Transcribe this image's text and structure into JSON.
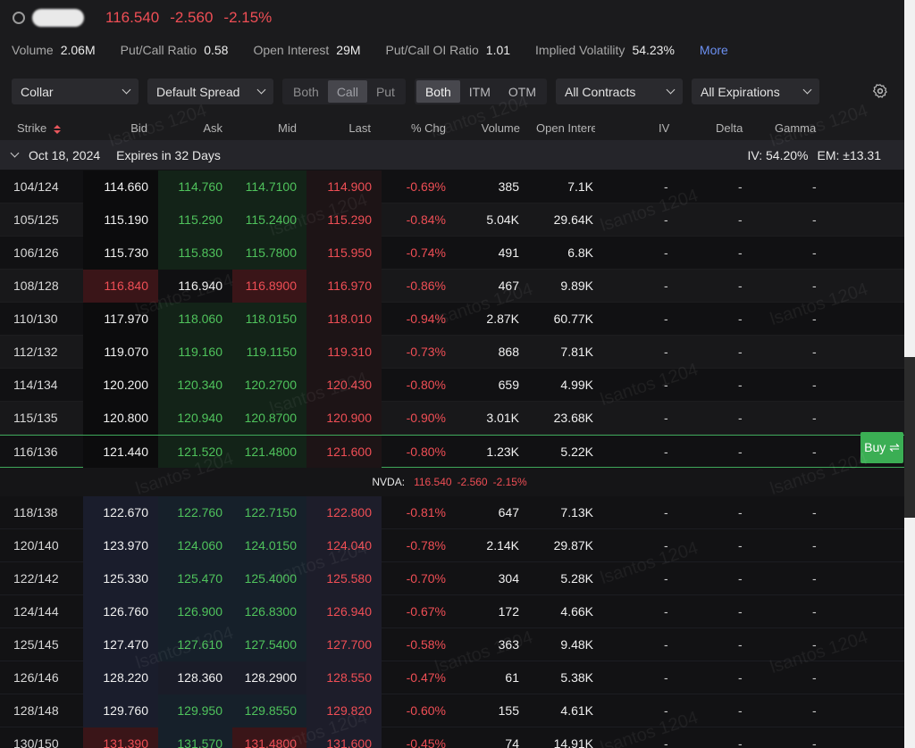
{
  "quote": {
    "price": "116.540",
    "change": "-2.560",
    "change_pct": "-2.15%"
  },
  "stats": [
    {
      "label": "Volume",
      "value": "2.06M"
    },
    {
      "label": "Put/Call Ratio",
      "value": "0.58"
    },
    {
      "label": "Open Interest",
      "value": "29M"
    },
    {
      "label": "Put/Call OI Ratio",
      "value": "1.01"
    },
    {
      "label": "Implied Volatility",
      "value": "54.23%"
    }
  ],
  "more_label": "More",
  "toolbar": {
    "strategy": "Collar",
    "spread": "Default Spread",
    "side_options": [
      "Both",
      "Call",
      "Put"
    ],
    "side_selected": "Call",
    "money_options": [
      "Both",
      "ITM",
      "OTM"
    ],
    "money_selected": "Both",
    "contracts": "All Contracts",
    "expirations": "All Expirations"
  },
  "columns": {
    "strike": "Strike",
    "bid": "Bid",
    "ask": "Ask",
    "mid": "Mid",
    "last": "Last",
    "chg": "% Chg",
    "volume": "Volume",
    "oi": "Open Intere",
    "iv": "IV",
    "delta": "Delta",
    "gamma": "Gamma"
  },
  "expiry": {
    "date": "Oct 18, 2024",
    "days": "Expires in 32 Days",
    "iv": "IV: 54.20%",
    "em": "EM: ±13.31"
  },
  "underlying": {
    "label": "NVDA:",
    "price": "116.540",
    "change": "-2.560",
    "change_pct": "-2.15%"
  },
  "buy_label": "Buy ⇌",
  "watermark": "lsantos 1204",
  "colors": {
    "green": "#4fc35c",
    "red": "#ef4e55",
    "buy": "#3bae54",
    "link": "#6b8ff0"
  },
  "rows_above": [
    {
      "strike": "104/124",
      "bid": "114.660",
      "ask": "114.760",
      "mid": "114.7100",
      "last": "114.900",
      "chg": "-0.69%",
      "volume": "385",
      "oi": "7.1K",
      "iv": "-",
      "delta": "-",
      "gamma": "-",
      "tone": [
        "white",
        "green",
        "green",
        "red"
      ]
    },
    {
      "strike": "105/125",
      "bid": "115.190",
      "ask": "115.290",
      "mid": "115.2400",
      "last": "115.290",
      "chg": "-0.84%",
      "volume": "5.04K",
      "oi": "29.64K",
      "iv": "-",
      "delta": "-",
      "gamma": "-",
      "tone": [
        "white",
        "green",
        "green",
        "red"
      ]
    },
    {
      "strike": "106/126",
      "bid": "115.730",
      "ask": "115.830",
      "mid": "115.7800",
      "last": "115.950",
      "chg": "-0.74%",
      "volume": "491",
      "oi": "6.8K",
      "iv": "-",
      "delta": "-",
      "gamma": "-",
      "tone": [
        "white",
        "green",
        "green",
        "red"
      ]
    },
    {
      "strike": "108/128",
      "bid": "116.840",
      "ask": "116.940",
      "mid": "116.8900",
      "last": "116.970",
      "chg": "-0.86%",
      "volume": "467",
      "oi": "9.89K",
      "iv": "-",
      "delta": "-",
      "gamma": "-",
      "tone": [
        "red",
        "white",
        "red",
        "red"
      ]
    },
    {
      "strike": "110/130",
      "bid": "117.970",
      "ask": "118.060",
      "mid": "118.0150",
      "last": "118.010",
      "chg": "-0.94%",
      "volume": "2.87K",
      "oi": "60.77K",
      "iv": "-",
      "delta": "-",
      "gamma": "-",
      "tone": [
        "white",
        "green",
        "green",
        "red"
      ]
    },
    {
      "strike": "112/132",
      "bid": "119.070",
      "ask": "119.160",
      "mid": "119.1150",
      "last": "119.310",
      "chg": "-0.73%",
      "volume": "868",
      "oi": "7.81K",
      "iv": "-",
      "delta": "-",
      "gamma": "-",
      "tone": [
        "white",
        "green",
        "green",
        "red"
      ]
    },
    {
      "strike": "114/134",
      "bid": "120.200",
      "ask": "120.340",
      "mid": "120.2700",
      "last": "120.430",
      "chg": "-0.80%",
      "volume": "659",
      "oi": "4.99K",
      "iv": "-",
      "delta": "-",
      "gamma": "-",
      "tone": [
        "white",
        "green",
        "green",
        "red"
      ]
    },
    {
      "strike": "115/135",
      "bid": "120.800",
      "ask": "120.940",
      "mid": "120.8700",
      "last": "120.900",
      "chg": "-0.90%",
      "volume": "3.01K",
      "oi": "23.68K",
      "iv": "-",
      "delta": "-",
      "gamma": "-",
      "tone": [
        "white",
        "green",
        "green",
        "red"
      ]
    },
    {
      "strike": "116/136",
      "bid": "121.440",
      "ask": "121.520",
      "mid": "121.4800",
      "last": "121.600",
      "chg": "-0.80%",
      "volume": "1.23K",
      "oi": "5.22K",
      "iv": "-",
      "delta": "-",
      "gamma": "-",
      "tone": [
        "white",
        "green",
        "green",
        "red"
      ]
    }
  ],
  "rows_below": [
    {
      "strike": "118/138",
      "bid": "122.670",
      "ask": "122.760",
      "mid": "122.7150",
      "last": "122.800",
      "chg": "-0.81%",
      "volume": "647",
      "oi": "7.13K",
      "iv": "-",
      "delta": "-",
      "gamma": "-",
      "tone": [
        "white",
        "green",
        "green",
        "red"
      ]
    },
    {
      "strike": "120/140",
      "bid": "123.970",
      "ask": "124.060",
      "mid": "124.0150",
      "last": "124.040",
      "chg": "-0.78%",
      "volume": "2.14K",
      "oi": "29.87K",
      "iv": "-",
      "delta": "-",
      "gamma": "-",
      "tone": [
        "white",
        "green",
        "green",
        "red"
      ]
    },
    {
      "strike": "122/142",
      "bid": "125.330",
      "ask": "125.470",
      "mid": "125.4000",
      "last": "125.580",
      "chg": "-0.70%",
      "volume": "304",
      "oi": "5.28K",
      "iv": "-",
      "delta": "-",
      "gamma": "-",
      "tone": [
        "white",
        "green",
        "green",
        "red"
      ]
    },
    {
      "strike": "124/144",
      "bid": "126.760",
      "ask": "126.900",
      "mid": "126.8300",
      "last": "126.940",
      "chg": "-0.67%",
      "volume": "172",
      "oi": "4.66K",
      "iv": "-",
      "delta": "-",
      "gamma": "-",
      "tone": [
        "white",
        "green",
        "green",
        "red"
      ]
    },
    {
      "strike": "125/145",
      "bid": "127.470",
      "ask": "127.610",
      "mid": "127.5400",
      "last": "127.700",
      "chg": "-0.58%",
      "volume": "363",
      "oi": "9.48K",
      "iv": "-",
      "delta": "-",
      "gamma": "-",
      "tone": [
        "white",
        "green",
        "green",
        "red"
      ]
    },
    {
      "strike": "126/146",
      "bid": "128.220",
      "ask": "128.360",
      "mid": "128.2900",
      "last": "128.550",
      "chg": "-0.47%",
      "volume": "61",
      "oi": "5.38K",
      "iv": "-",
      "delta": "-",
      "gamma": "-",
      "tone": [
        "white",
        "white",
        "white",
        "red"
      ]
    },
    {
      "strike": "128/148",
      "bid": "129.760",
      "ask": "129.950",
      "mid": "129.8550",
      "last": "129.820",
      "chg": "-0.60%",
      "volume": "155",
      "oi": "4.61K",
      "iv": "-",
      "delta": "-",
      "gamma": "-",
      "tone": [
        "white",
        "green",
        "green",
        "red"
      ]
    },
    {
      "strike": "130/150",
      "bid": "131.390",
      "ask": "131.570",
      "mid": "131.4800",
      "last": "131.600",
      "chg": "-0.45%",
      "volume": "74",
      "oi": "14.91K",
      "iv": "-",
      "delta": "-",
      "gamma": "-",
      "tone": [
        "red",
        "green",
        "red",
        "red"
      ]
    }
  ]
}
